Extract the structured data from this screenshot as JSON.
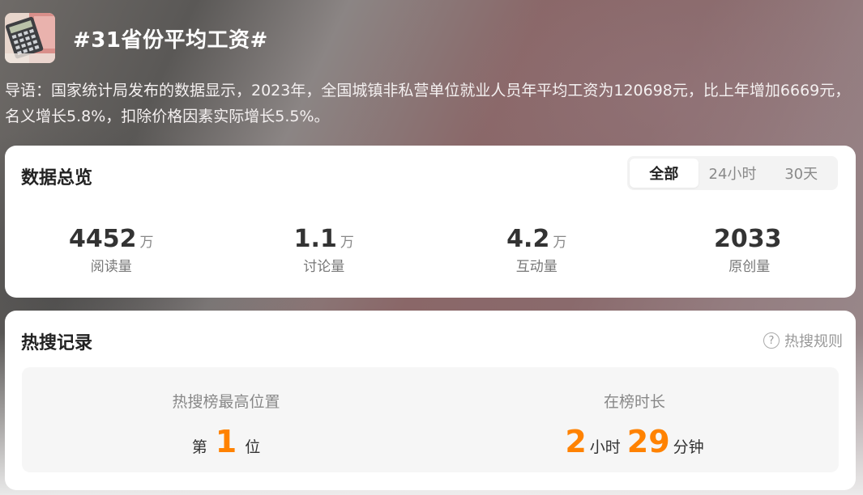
{
  "topic": {
    "title": "#31省份平均工资#",
    "intro": "导语：国家统计局发布的数据显示，2023年，全国城镇非私营单位就业人员年平均工资为120698元，比上年增加6669元，名义增长5.8%，扣除价格因素实际增长5.5%。"
  },
  "overview": {
    "title": "数据总览",
    "tabs": [
      {
        "label": "全部",
        "active": true
      },
      {
        "label": "24小时",
        "active": false
      },
      {
        "label": "30天",
        "active": false
      }
    ],
    "stats": [
      {
        "value": "4452",
        "unit": "万",
        "label": "阅读量"
      },
      {
        "value": "1.1",
        "unit": "万",
        "label": "讨论量"
      },
      {
        "value": "4.2",
        "unit": "万",
        "label": "互动量"
      },
      {
        "value": "2033",
        "unit": "",
        "label": "原创量"
      }
    ]
  },
  "hot": {
    "title": "热搜记录",
    "rules_label": "热搜规则",
    "rules_icon": "question-circle-icon",
    "highest": {
      "label": "热搜榜最高位置",
      "prefix": "第",
      "value": "1",
      "suffix": "位"
    },
    "duration": {
      "label": "在榜时长",
      "hours": "2",
      "hours_unit": "小时",
      "minutes": "29",
      "minutes_unit": "分钟"
    }
  },
  "colors": {
    "accent": "#ff8200",
    "card": "#ffffff",
    "text_dark": "#333333"
  }
}
